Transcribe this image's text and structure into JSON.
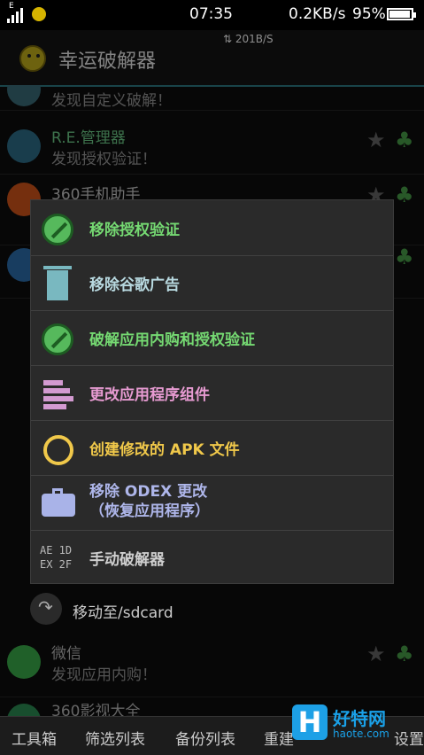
{
  "status_bar": {
    "network_label": "E",
    "time": "07:35",
    "net_speed": "0.2KB/s",
    "battery_percent": "95%",
    "battery_level": 0.95,
    "transfer_speed": "201B/S"
  },
  "app": {
    "title": "幸运破解器"
  },
  "list": {
    "items": [
      {
        "name": "",
        "status": "发现自定义破解！"
      },
      {
        "name": "R.E.管理器",
        "status": "发现授权验证！"
      },
      {
        "name": "360手机助手",
        "status": ""
      },
      {
        "name": "微信",
        "status": "发现应用内购！"
      },
      {
        "name": "360影视大全",
        "status": ""
      }
    ],
    "move_label": "移动至/sdcard"
  },
  "menu": {
    "items": [
      {
        "label": "移除授权验证",
        "icon": "no-sign-icon"
      },
      {
        "label": "移除谷歌广告",
        "icon": "trash-icon"
      },
      {
        "label": "破解应用内购和授权验证",
        "icon": "no-sign-icon"
      },
      {
        "label": "更改应用程序组件",
        "icon": "component-stack-icon"
      },
      {
        "label": "创建修改的 APK 文件",
        "icon": "rebuild-icon"
      },
      {
        "label": "移除 ODEX 更改\n（恢复应用程序）",
        "icon": "briefcase-icon"
      },
      {
        "label": "手动破解器",
        "icon": "hex-code-icon"
      }
    ],
    "hex_icon_text": "AE 1D\nEX 2F"
  },
  "bottom_tabs": [
    "工具箱",
    "筛选列表",
    "备份列表",
    "重建",
    "设置"
  ],
  "watermark": {
    "logo": "H",
    "name": "好特网",
    "url": "haote.com"
  },
  "colors": {
    "accent": "#2e7c86",
    "menu_bg": "#2a2a2a",
    "green": "#75d972",
    "pink": "#e79bd2",
    "gold": "#f0c84a",
    "lavender": "#aeb6ea"
  }
}
